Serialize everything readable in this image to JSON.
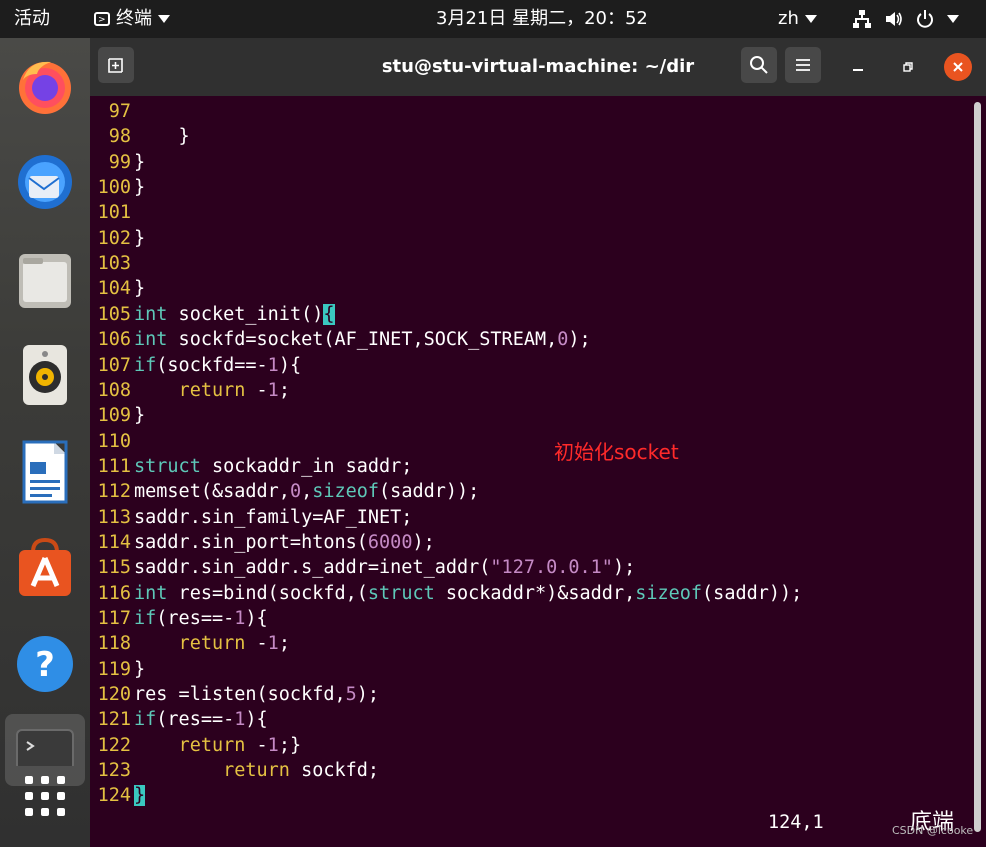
{
  "topbar": {
    "activities": "活动",
    "app_menu": "终端",
    "clock": "3月21日 星期二，20：52",
    "input_method": "zh"
  },
  "dock": {
    "items": [
      {
        "name": "firefox-icon"
      },
      {
        "name": "thunderbird-icon"
      },
      {
        "name": "files-icon"
      },
      {
        "name": "rhythmbox-icon"
      },
      {
        "name": "libreoffice-writer-icon"
      },
      {
        "name": "software-center-icon"
      },
      {
        "name": "help-icon"
      },
      {
        "name": "terminal-dock-icon"
      },
      {
        "name": "show-apps-icon"
      }
    ]
  },
  "window": {
    "title": "stu@stu-virtual-machine: ~/dir"
  },
  "code": {
    "lines": [
      {
        "n": "97",
        "t": ""
      },
      {
        "n": "98",
        "t": "    }"
      },
      {
        "n": "99",
        "t": "}"
      },
      {
        "n": "100",
        "t": "}"
      },
      {
        "n": "101",
        "t": ""
      },
      {
        "n": "102",
        "t": "}"
      },
      {
        "n": "103",
        "t": ""
      },
      {
        "n": "104",
        "t": "}"
      },
      {
        "n": "105",
        "t": "int socket_init(){"
      },
      {
        "n": "106",
        "t": "int sockfd=socket(AF_INET,SOCK_STREAM,0);"
      },
      {
        "n": "107",
        "t": "if(sockfd==-1){"
      },
      {
        "n": "108",
        "t": "    return -1;"
      },
      {
        "n": "109",
        "t": "}"
      },
      {
        "n": "110",
        "t": ""
      },
      {
        "n": "111",
        "t": "struct sockaddr_in saddr;"
      },
      {
        "n": "112",
        "t": "memset(&saddr,0,sizeof(saddr));"
      },
      {
        "n": "113",
        "t": "saddr.sin_family=AF_INET;"
      },
      {
        "n": "114",
        "t": "saddr.sin_port=htons(6000);"
      },
      {
        "n": "115",
        "t": "saddr.sin_addr.s_addr=inet_addr(\"127.0.0.1\");"
      },
      {
        "n": "116",
        "t": "int res=bind(sockfd,(struct sockaddr*)&saddr,sizeof(saddr));"
      },
      {
        "n": "117",
        "t": "if(res==-1){"
      },
      {
        "n": "118",
        "t": "    return -1;"
      },
      {
        "n": "119",
        "t": "}"
      },
      {
        "n": "120",
        "t": "res =listen(sockfd,5);"
      },
      {
        "n": "121",
        "t": "if(res==-1){"
      },
      {
        "n": "122",
        "t": "    return -1;}"
      },
      {
        "n": "123",
        "t": "        return sockfd;"
      },
      {
        "n": "124",
        "t": "}"
      }
    ],
    "annotation": "初始化socket",
    "cursor_position": "124,1",
    "scroll_indicator": "底端",
    "watermark": "CSDN @lcooke"
  },
  "colors": {
    "terminal_bg": "#2c001e",
    "line_number": "#e4c142",
    "keyword": "#5ec8b8",
    "number": "#c58ac5",
    "annotation": "#ff2a2a",
    "close_button": "#e95420"
  }
}
